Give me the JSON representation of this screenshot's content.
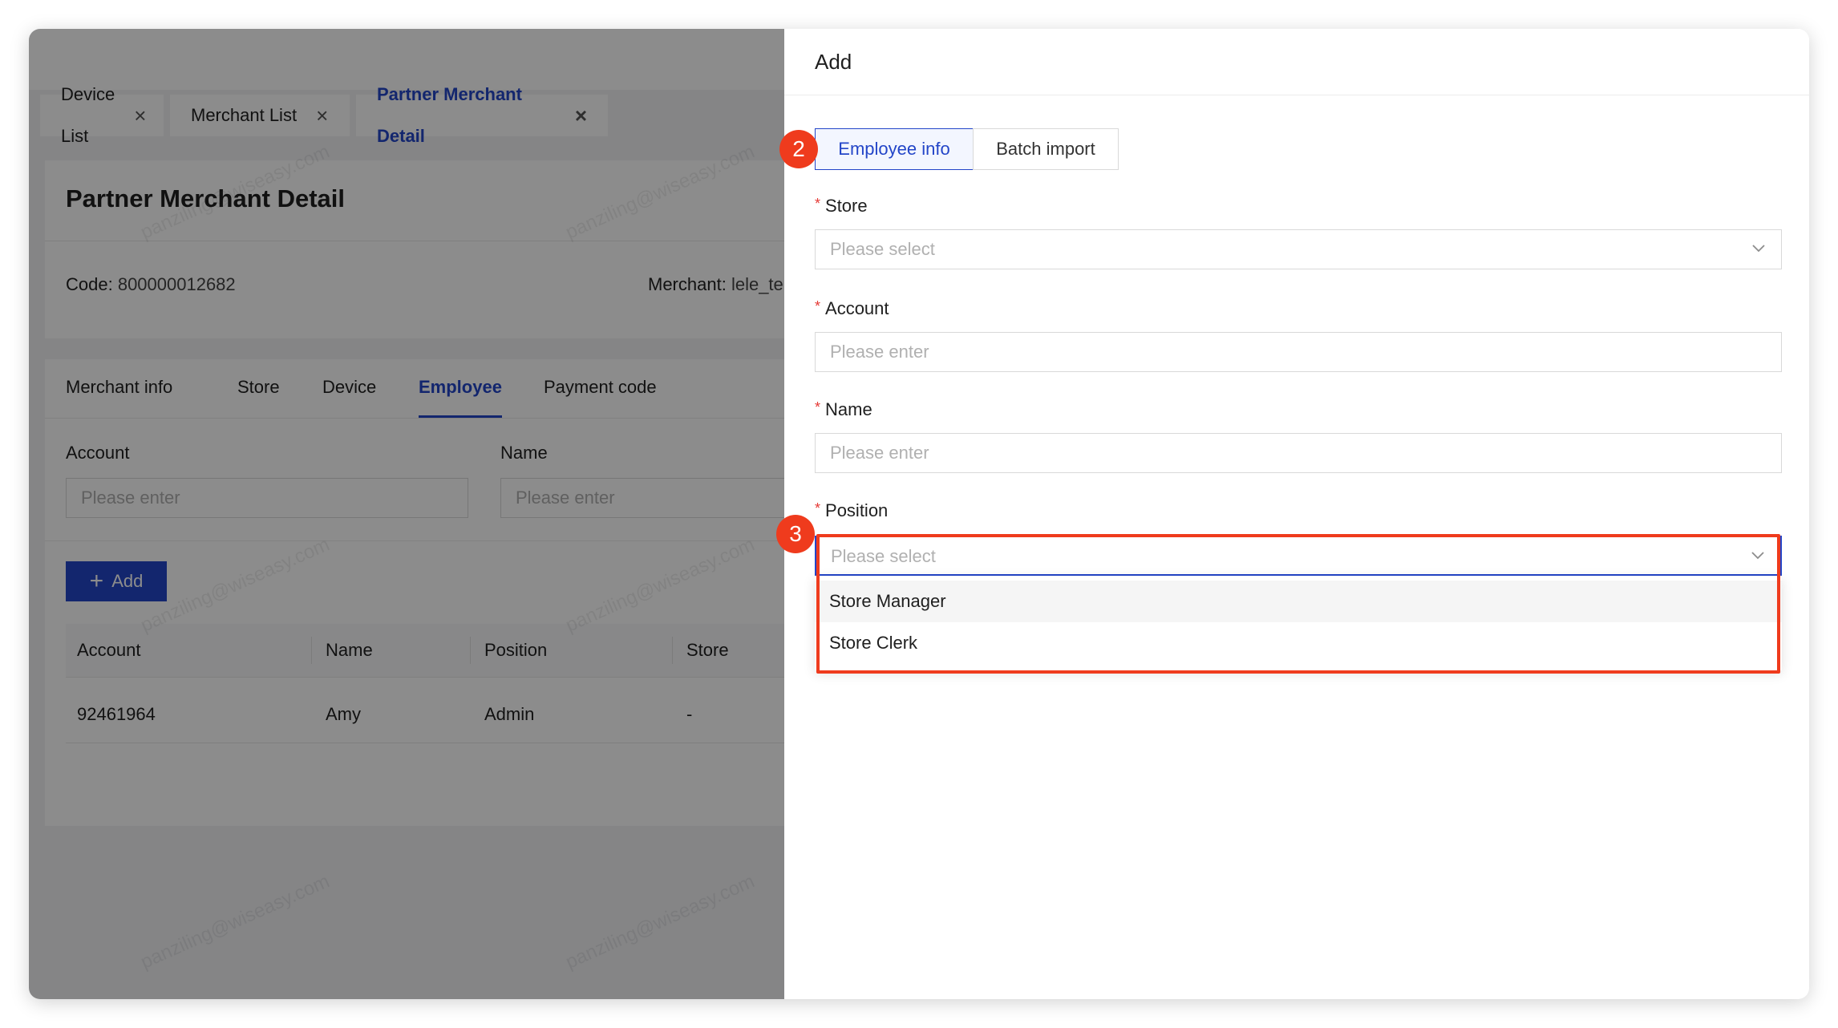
{
  "page_tabs": [
    {
      "label": "Device List"
    },
    {
      "label": "Merchant List"
    },
    {
      "label": "Partner Merchant Detail"
    }
  ],
  "detail": {
    "title": "Partner Merchant Detail",
    "code_label": "Code",
    "code_value": "800000012682",
    "merchant_label": "Merchant",
    "merchant_value": "lele_te"
  },
  "sub_tabs": [
    "Merchant info",
    "Store",
    "Device",
    "Employee",
    "Payment code"
  ],
  "filters": {
    "account_label": "Account",
    "account_placeholder": "Please enter",
    "name_label": "Name",
    "name_placeholder": "Please enter"
  },
  "add_button_label": "Add",
  "table": {
    "columns": [
      "Account",
      "Name",
      "Position",
      "Store"
    ],
    "rows": [
      {
        "account": "92461964",
        "name": "Amy",
        "position": "Admin",
        "store": "-"
      }
    ]
  },
  "watermark_text": "panziling@wiseasy.com",
  "drawer": {
    "title": "Add",
    "segments": [
      "Employee info",
      "Batch import"
    ],
    "fields": {
      "store": {
        "label": "Store",
        "placeholder": "Please select"
      },
      "account": {
        "label": "Account",
        "placeholder": "Please enter"
      },
      "name": {
        "label": "Name",
        "placeholder": "Please enter"
      },
      "position": {
        "label": "Position",
        "placeholder": "Please select"
      }
    },
    "position_options": [
      "Store Manager",
      "Store Clerk"
    ]
  },
  "annotations": {
    "step_2": "2",
    "step_3": "3"
  },
  "colors": {
    "accent": "#2345c8",
    "highlight": "#ef3b1d",
    "required": "#e53935"
  }
}
